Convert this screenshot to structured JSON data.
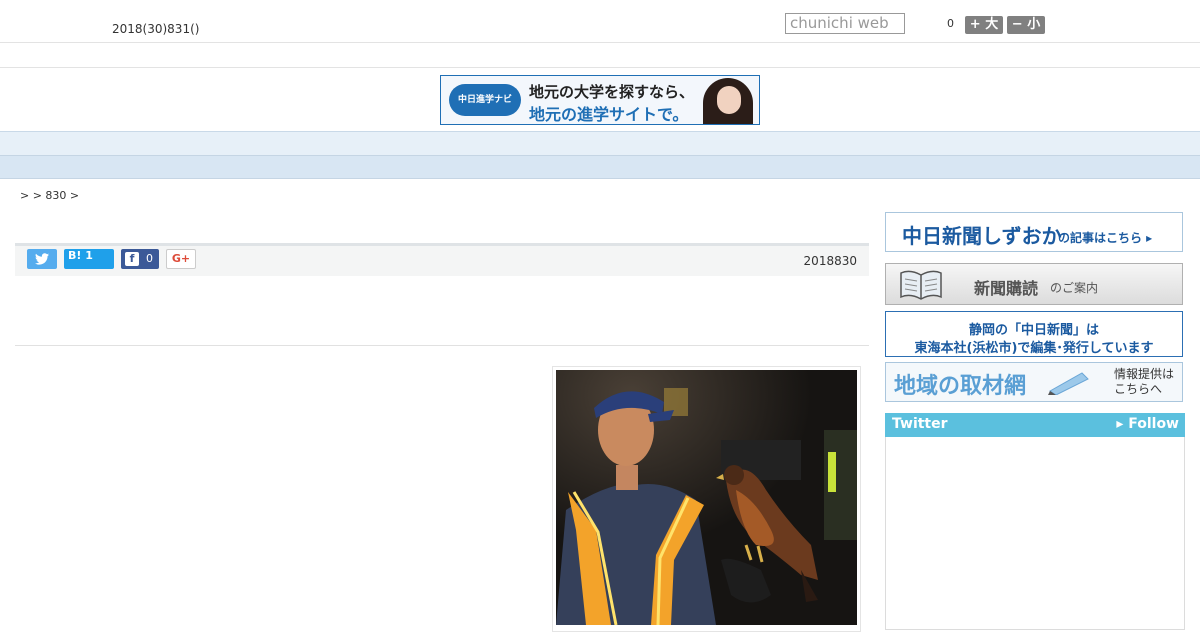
{
  "header": {
    "date": "2018(30)831()",
    "search_placeholder": "chunichi web",
    "font_count": "0",
    "font_large": "+ 大",
    "font_small": "− 小"
  },
  "ad": {
    "logo": "中日進学ナビ",
    "line1": "地元の大学を探すなら、",
    "line2": "地元の進学サイトで。"
  },
  "nav": {
    "items": [
      "",
      "",
      "",
      "",
      "",
      "",
      "",
      "",
      ""
    ]
  },
  "breadcrumb": ">  > 830 >",
  "share": {
    "twitter_icon": "twitter-bird-icon",
    "hatena_label": "B! 1",
    "facebook_icon_label": "f",
    "facebook_count": "0",
    "gplus_label": "G+"
  },
  "article": {
    "date": "2018830"
  },
  "sidebar": {
    "shizuoka_title": "中日新聞しずおか",
    "shizuoka_sub": "の記事はこちら ▸",
    "subscribe_title": "新聞購読",
    "subscribe_sub": "のご案内",
    "tokai_line1": "静岡の「中日新聞」は",
    "tokai_line2": "東海本社(浜松市)で編集･発行しています",
    "network_title": "地域の取材網",
    "network_sub1": "情報提供は",
    "network_sub2": "こちらへ",
    "twitter_title": "Twitter",
    "twitter_follow": "▸ Follow"
  },
  "colors": {
    "nav_bg": "#e7f0f8",
    "subnav_bg": "#d8e6f3",
    "twitter_blue": "#5bc0de",
    "brand_blue": "#1b5aa0"
  }
}
